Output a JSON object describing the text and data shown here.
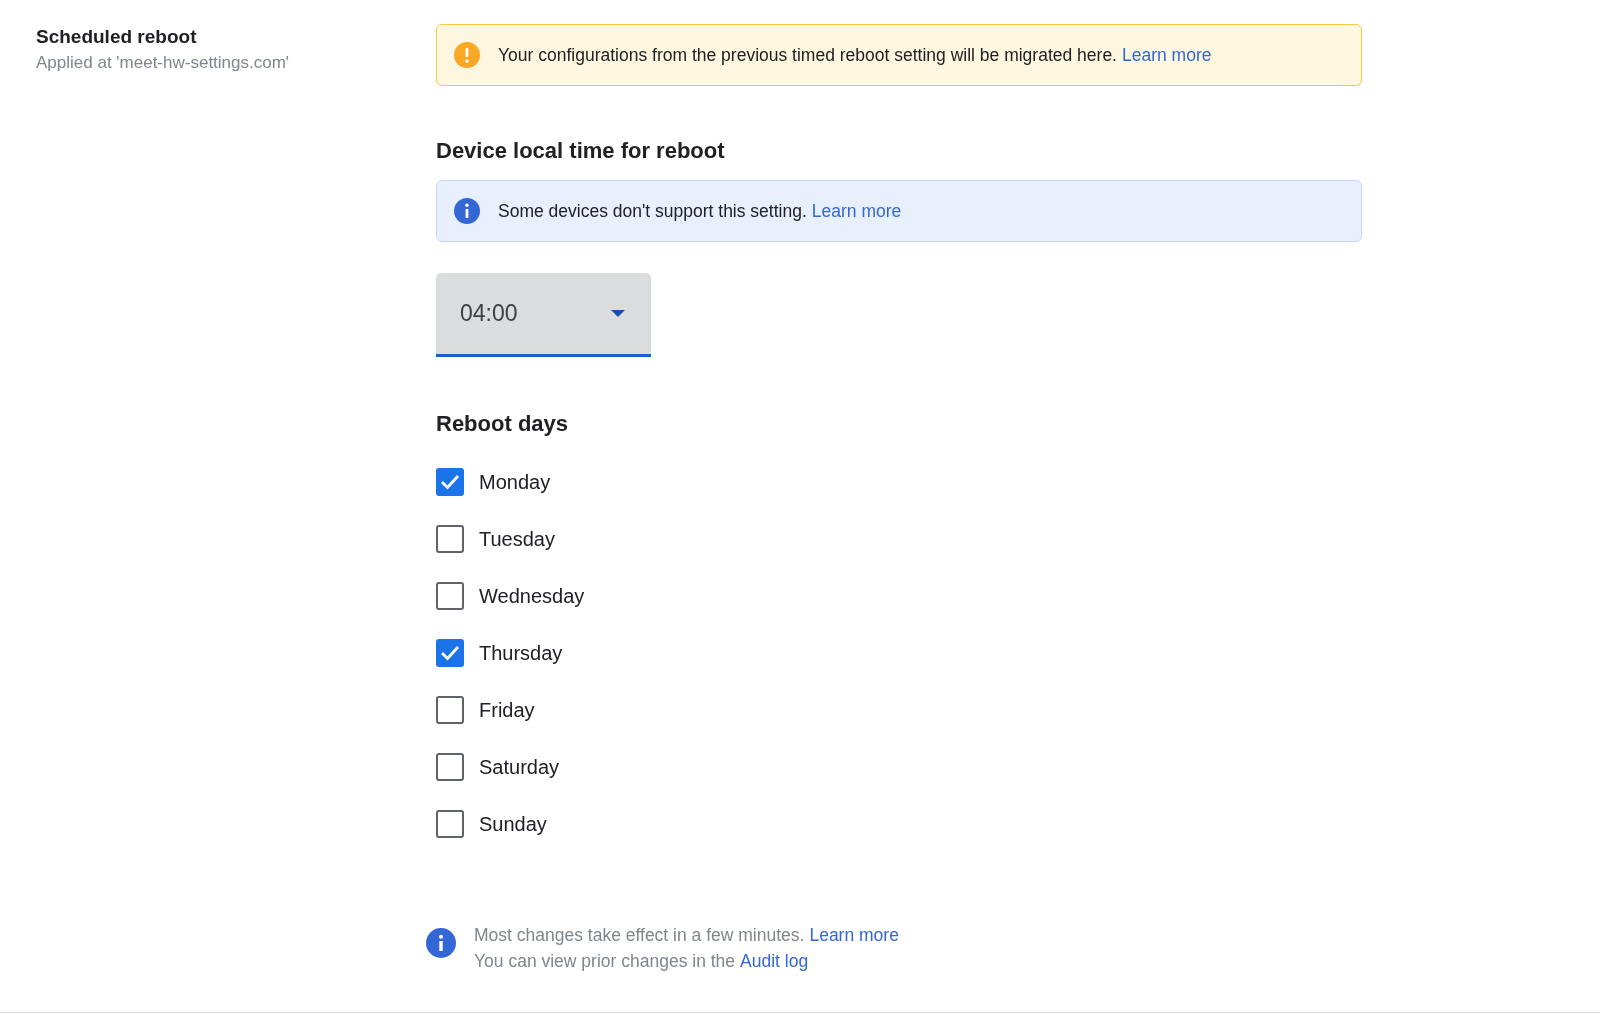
{
  "setting": {
    "title": "Scheduled reboot",
    "subtitle": "Applied at 'meet-hw-settings.com'"
  },
  "notices": [
    {
      "kind": "warning",
      "text": "Your configurations from the previous timed reboot setting will be migrated here.",
      "link": "Learn more"
    }
  ],
  "time_section": {
    "heading": "Device local time for reboot",
    "notice": {
      "kind": "info",
      "text": "Some devices don't support this setting.",
      "link": "Learn more"
    },
    "dropdown": {
      "value": "04:00"
    }
  },
  "days_section": {
    "heading": "Reboot days",
    "days": [
      {
        "label": "Monday",
        "checked": true
      },
      {
        "label": "Tuesday",
        "checked": false
      },
      {
        "label": "Wednesday",
        "checked": false
      },
      {
        "label": "Thursday",
        "checked": true
      },
      {
        "label": "Friday",
        "checked": false
      },
      {
        "label": "Saturday",
        "checked": false
      },
      {
        "label": "Sunday",
        "checked": false
      }
    ]
  },
  "footer": {
    "lines": [
      {
        "text": "Most changes take effect in a few minutes.",
        "link": "Learn more"
      },
      {
        "text": "You can view prior changes in the",
        "link": "Audit log"
      }
    ]
  }
}
